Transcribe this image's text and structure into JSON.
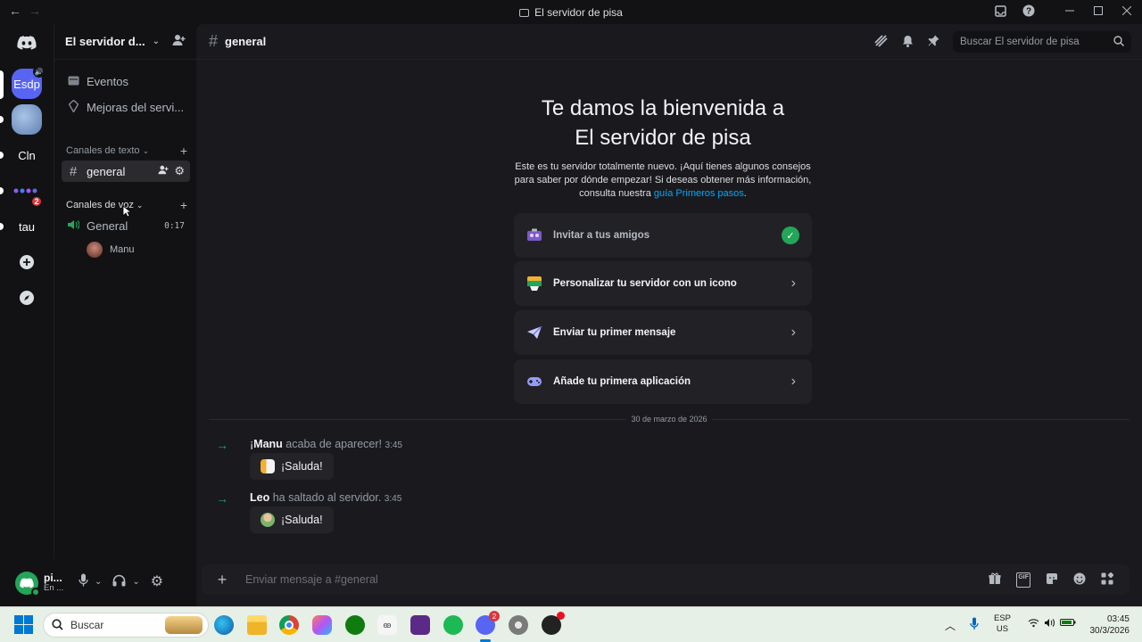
{
  "window": {
    "title": "El servidor de pisa",
    "back_glyph": "←",
    "forward_glyph": "→"
  },
  "servers": [
    {
      "label": "Esdp",
      "color": "#5865f2",
      "badge": ""
    },
    {
      "label": "",
      "color": "#6f8fc0",
      "badge": ""
    },
    {
      "label": "Cln",
      "color": "#121214",
      "badge": ""
    },
    {
      "label": "",
      "color": "#2b2d31",
      "badge": "2"
    },
    {
      "label": "tau",
      "color": "#121214",
      "badge": ""
    }
  ],
  "server_header": {
    "name": "El servidor d..."
  },
  "channel_list": {
    "events": "Eventos",
    "boosts": "Mejoras del servi...",
    "text_category": "Canales de texto",
    "text_channel": "general",
    "voice_category": "Canales de voz",
    "voice_channel": "General",
    "voice_timer": "0:17",
    "voice_user": "Manu"
  },
  "user_panel": {
    "name": "pi...",
    "status": "En ..."
  },
  "chat_header": {
    "channel": "general",
    "search_placeholder": "Buscar El servidor de pisa"
  },
  "welcome": {
    "title_line1": "Te damos la bienvenida a",
    "title_line2": "El servidor de pisa",
    "desc": "Este es tu servidor totalmente nuevo. ¡Aquí tienes algunos consejos para saber por dónde empezar! Si deseas obtener más información, consulta nuestra",
    "link": "guía Primeros pasos",
    "link_suffix": ".",
    "cards": [
      {
        "label": "Invitar a tus amigos",
        "done": true
      },
      {
        "label": "Personalizar tu servidor con un icono",
        "done": false
      },
      {
        "label": "Enviar tu primer mensaje",
        "done": false
      },
      {
        "label": "Añade tu primera aplicación",
        "done": false
      }
    ]
  },
  "date_divider": "30 de marzo de 2026",
  "messages": [
    {
      "prefix": "¡",
      "user": "Manu",
      "text": " acaba de aparecer!",
      "time": "3:45",
      "wave": "¡Saluda!"
    },
    {
      "prefix": "",
      "user": "Leo",
      "text": " ha saltado al servidor.",
      "time": "3:45",
      "wave": "¡Saluda!"
    }
  ],
  "composer": {
    "placeholder": "Enviar mensaje a #general",
    "gif": "GIF"
  },
  "taskbar": {
    "search": "Buscar",
    "lang_top": "ESP",
    "lang_bottom": "US",
    "time": "03:45",
    "date": "30/3/2026",
    "discord_badge": "2"
  },
  "colors": {
    "accent": "#5865f2",
    "online": "#23a55a",
    "link": "#00a8fc",
    "badge": "#da373c"
  }
}
